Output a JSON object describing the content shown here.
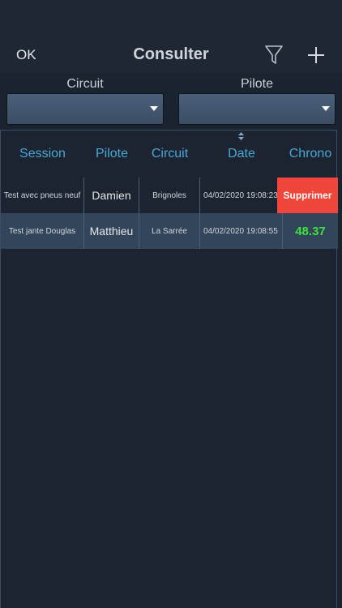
{
  "navbar": {
    "ok_label": "OK",
    "title": "Consulter",
    "filter_icon": "funnel-icon",
    "add_icon": "plus-icon"
  },
  "filters": {
    "circuit_label": "Circuit",
    "pilote_label": "Pilote",
    "circuit_value": "",
    "pilote_value": ""
  },
  "table": {
    "columns": [
      "Session",
      "Pilote",
      "Circuit",
      "Date",
      "Chrono"
    ],
    "sorted_column": "Date",
    "rows": [
      {
        "session": "Test avec pneus neuf",
        "pilote": "Damien",
        "circuit": "Brignoles",
        "date": "04/02/2020 19:08:23",
        "chrono": "",
        "swipe_action": "Supprimer"
      },
      {
        "session": "Test jante Douglas",
        "pilote": "Matthieu",
        "circuit": "La Sarrée",
        "date": "04/02/2020 19:08:55",
        "chrono": "48.37"
      }
    ]
  },
  "colors": {
    "accent_header": "#4aa6d6",
    "chrono_green": "#3ee03e",
    "delete_red": "#f0453a",
    "background": "#1a2330"
  }
}
